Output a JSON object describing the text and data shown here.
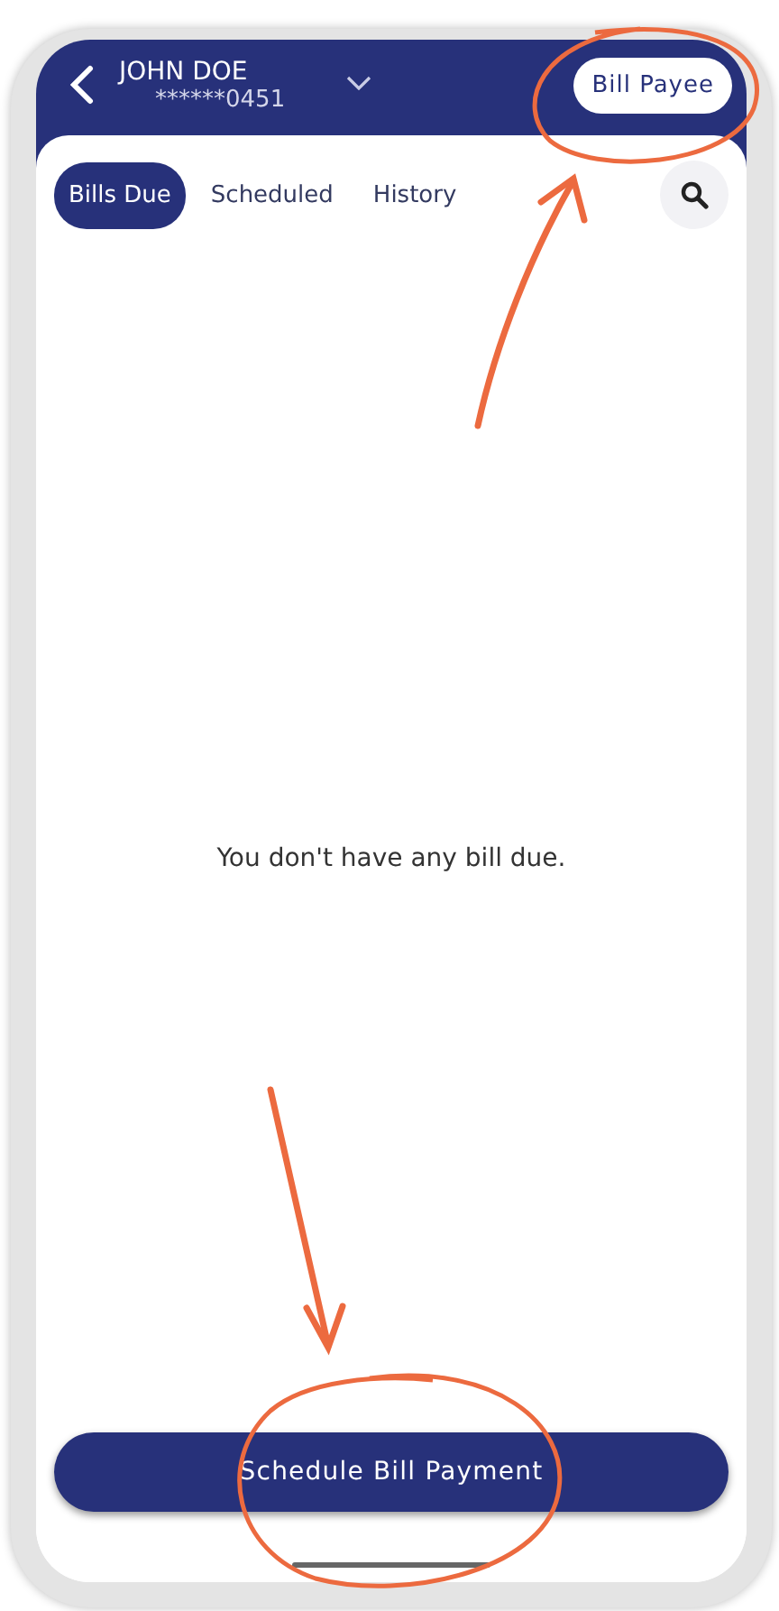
{
  "header": {
    "account_name": "JOHN DOE",
    "account_number": "******0451",
    "payee_button": "Bill Payee"
  },
  "tabs": [
    {
      "label": "Bills Due",
      "selected": true
    },
    {
      "label": "Scheduled",
      "selected": false
    },
    {
      "label": "History",
      "selected": false
    }
  ],
  "empty_message": "You don't have any bill due.",
  "primary_button": "Schedule Bill Payment"
}
